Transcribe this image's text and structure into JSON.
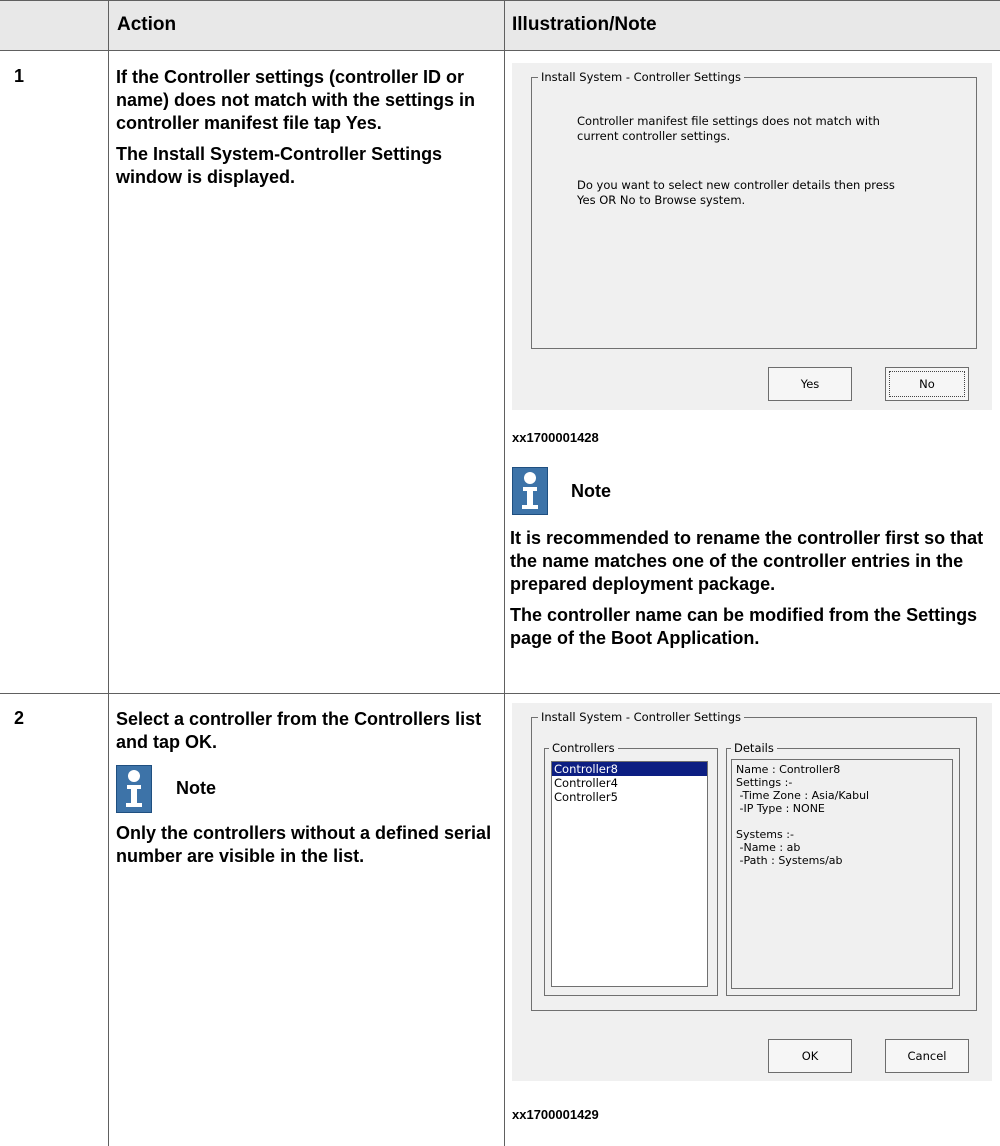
{
  "table": {
    "col_step_header": "",
    "col_action_header": "Action",
    "col_note_header": "Illustration/Note"
  },
  "steps": [
    {
      "number": "1",
      "action_p1_a": "If the Controller settings (controller ID or name) does not match with the settings in controller manifest file tap ",
      "action_p1_b": "Yes",
      "action_p1_c": ".",
      "action_p2_a": "The ",
      "action_p2_b": "Install System-Controller Settings",
      "action_p2_c": " window is displayed.",
      "dialog": {
        "title": "Install System - Controller Settings",
        "message1_line1": "Controller manifest file settings does not match with",
        "message1_line2": "current controller settings.",
        "message2_line1": "Do you want to select new controller details then press",
        "message2_line2": "Yes OR No to Browse system.",
        "yes_label": "Yes",
        "no_label": "No"
      },
      "caption": "xx1700001428",
      "note": {
        "title": "Note",
        "text1": "It is recommended to rename the controller first so that the name matches one of the controller entries in the prepared deployment package.",
        "text2_a": "The controller name can be modified from the ",
        "text2_b": "Settings",
        "text2_c": " page of the Boot Application."
      }
    },
    {
      "number": "2",
      "action_a": "Select a controller from the ",
      "action_b": "Controllers",
      "action_c": " list and tap ",
      "action_d": "OK",
      "action_e": ".",
      "note_title": "Note",
      "note_text": "Only the controllers without a defined serial number are visible in the list.",
      "dialog": {
        "title": "Install System - Controller Settings",
        "controllers_legend": "Controllers",
        "details_legend": "Details",
        "controllers": [
          "Controller8",
          "Controller4",
          "Controller5"
        ],
        "selected_index": 0,
        "details_lines": [
          "Name : Controller8",
          "Settings :-",
          " -Time Zone : Asia/Kabul",
          " -IP Type : NONE",
          "",
          "Systems :-",
          " -Name : ab",
          " -Path : Systems/ab"
        ],
        "ok_label": "OK",
        "cancel_label": "Cancel"
      },
      "caption": "xx1700001429"
    }
  ]
}
